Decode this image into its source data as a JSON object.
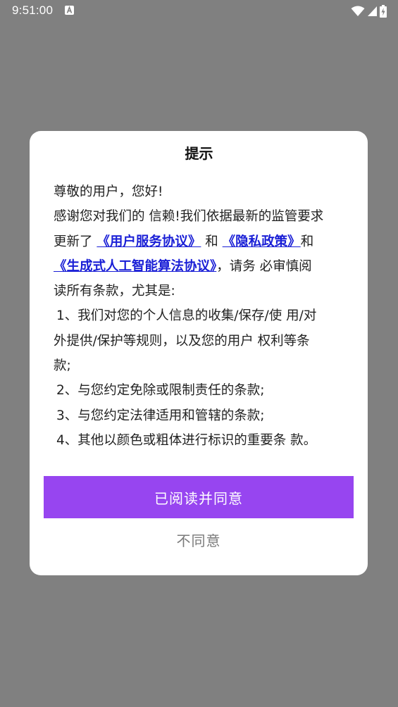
{
  "status_bar": {
    "time": "9:51:00",
    "icons": [
      "a-icon",
      "wifi-icon",
      "signal-icon",
      "battery-charging-icon"
    ]
  },
  "dialog": {
    "title": "提示",
    "greeting": "尊敬的用户，您好!",
    "line2": "感谢您对我们的 信赖!我们依据最新的监管要求",
    "line3_prefix": "更新了 ",
    "link_user_agreement": "《用户服务协议》",
    "line3_and": " 和 ",
    "link_privacy": "《隐私政策》",
    "line3_suffix": "和",
    "link_algorithm": "《生成式人工智能算法协议》",
    "line4_suffix": "，请务 必审慎阅",
    "line5": "读所有条款，尤其是:",
    "item1_line1": "1、我们对您的个人信息的收集/保存/使 用/对",
    "item1_line2": "外提供/保护等规则，以及您的用户 权利等条",
    "item1_line3": "款;",
    "item2": "2、与您约定免除或限制责任的条款;",
    "item3": "3、与您约定法律适用和管辖的条款;",
    "item4": "4、其他以颜色或粗体进行标识的重要条 款。",
    "agree_label": "已阅读并同意",
    "disagree_label": "不同意"
  },
  "colors": {
    "backdrop": "#808080",
    "dialog_bg": "#ffffff",
    "link": "#1a1fd6",
    "primary_button": "#9745f0",
    "secondary_text": "#7a7a7a"
  }
}
